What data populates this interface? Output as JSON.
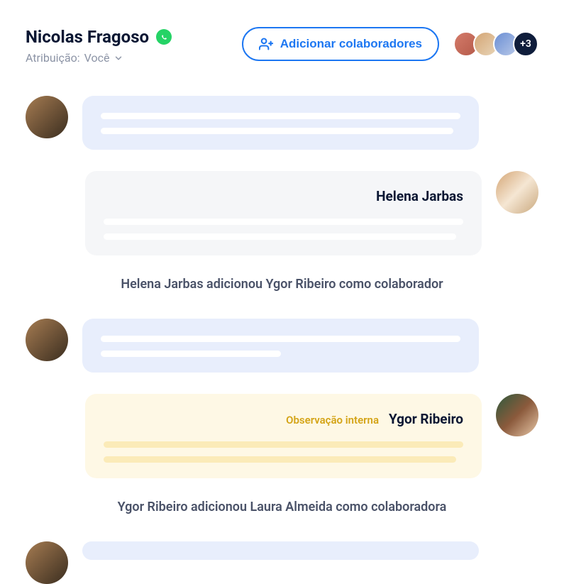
{
  "header": {
    "title": "Nicolas Fragoso",
    "assignment_label": "Atribuição:",
    "assignment_value": "Você",
    "add_collaborators_label": "Adicionar colaboradores",
    "more_count": "+3"
  },
  "messages": {
    "sender_helena": "Helena Jarbas",
    "sender_ygor": "Ygor Ribeiro",
    "internal_note_label": "Observação interna",
    "system_1": "Helena Jarbas adicionou Ygor Ribeiro como colaborador",
    "system_2": "Ygor Ribeiro adicionou Laura Almeida como colaboradora"
  }
}
